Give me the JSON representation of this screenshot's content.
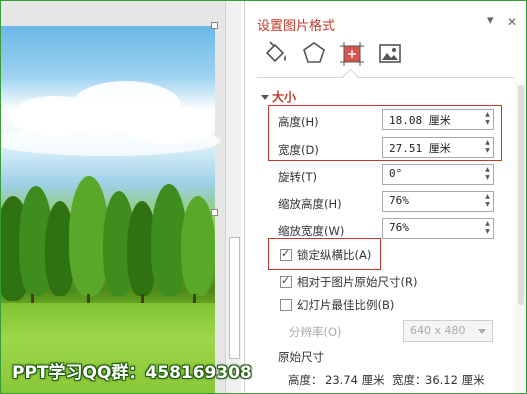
{
  "watermark": "PPT学习QQ群：458169308",
  "pane": {
    "title": "设置图片格式",
    "dropdown_glyph": "▾",
    "close_glyph": "✕",
    "tabs": [
      "fill-line-icon",
      "effects-icon",
      "size-properties-icon",
      "picture-icon"
    ],
    "active_tab": "size-properties-icon",
    "section_title": "大小",
    "height_label": "高度(H)",
    "height_value": "18.08 厘米",
    "width_label": "宽度(D)",
    "width_value": "27.51 厘米",
    "rotation_label": "旋转(T)",
    "rotation_value": "0°",
    "scale_height_label": "缩放高度(H)",
    "scale_height_value": "76%",
    "scale_width_label": "缩放宽度(W)",
    "scale_width_value": "76%",
    "lock_aspect_label": "锁定纵横比(A)",
    "lock_aspect_checked": true,
    "relative_original_label": "相对于图片原始尺寸(R)",
    "relative_original_checked": true,
    "best_scale_label": "幻灯片最佳比例(B)",
    "best_scale_checked": false,
    "resolution_label": "分辨率(O)",
    "resolution_value": "640 x 480",
    "original_size_title": "原始尺寸",
    "original_height_label": "高度：",
    "original_height_value": "23.74 厘米",
    "original_width_label": "宽度：",
    "original_width_value": "36.12 厘米"
  },
  "colors": {
    "accent": "#c0392b",
    "frame": "#3a9a3a"
  }
}
